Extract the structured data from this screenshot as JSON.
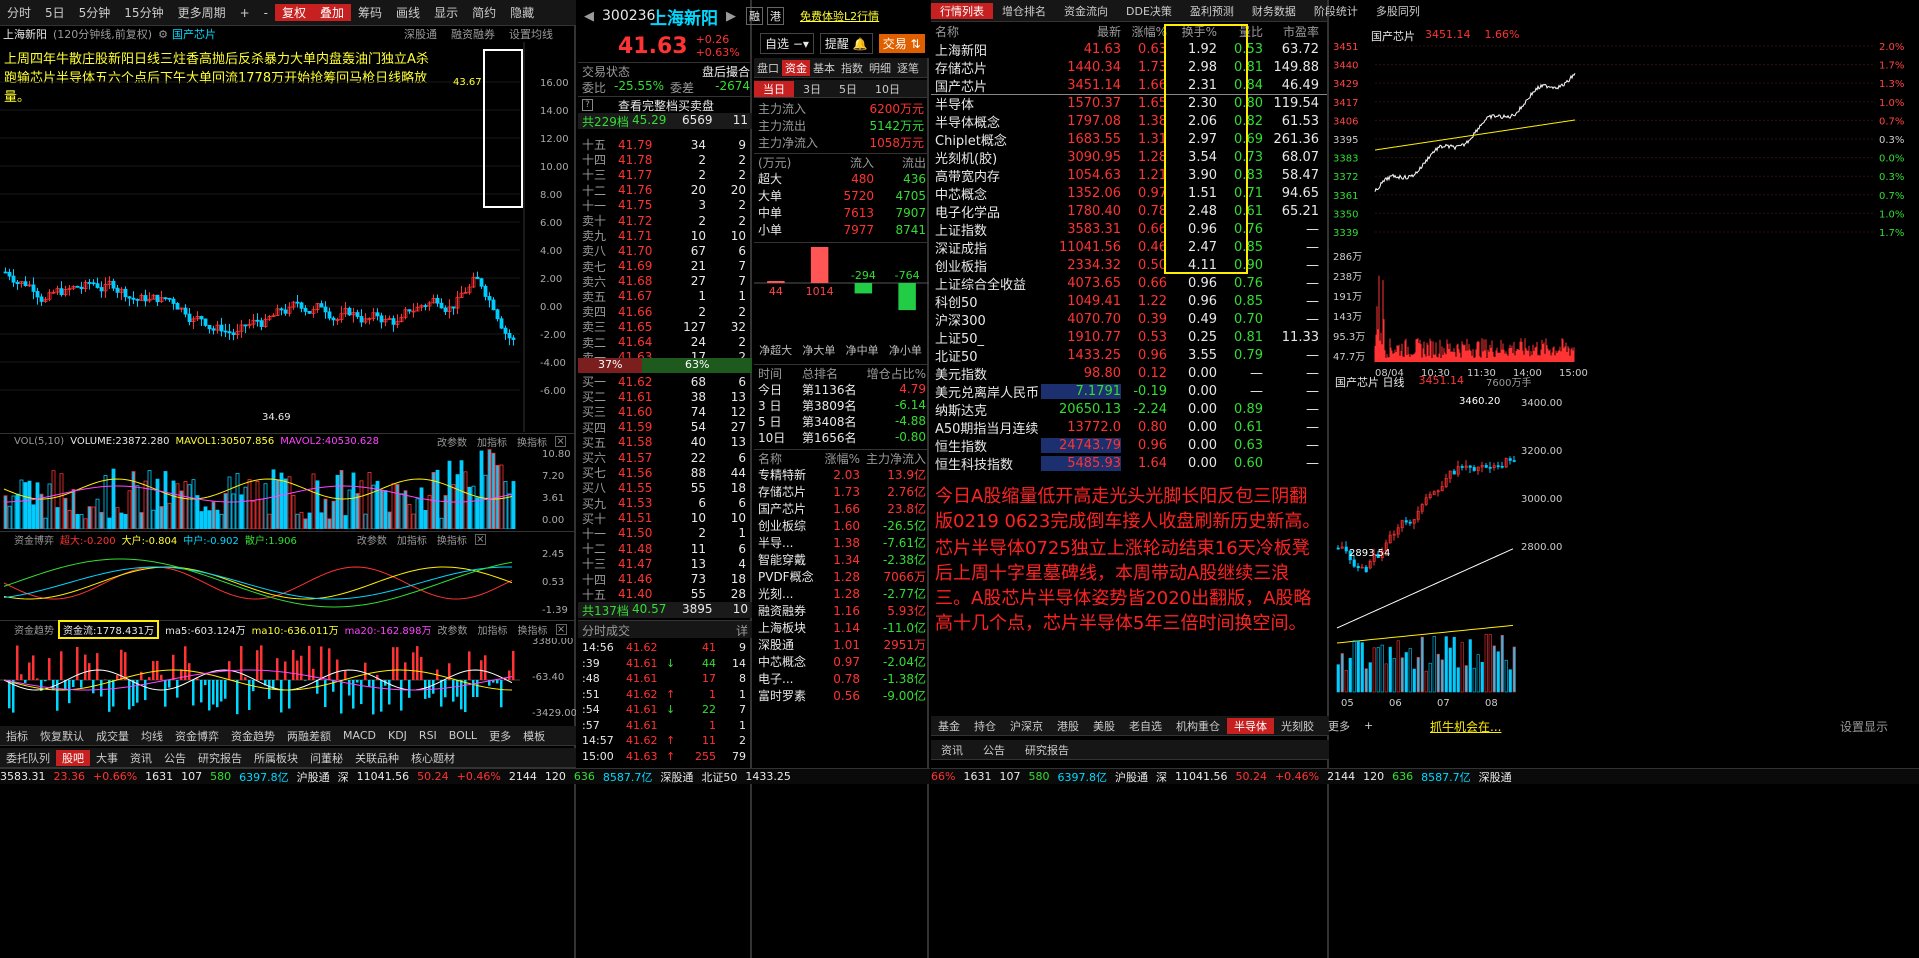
{
  "toolbar": {
    "items": [
      "分时",
      "5日",
      "5分钟",
      "15分钟",
      "更多周期",
      "+",
      "-",
      "复权",
      "叠加",
      "筹码",
      "画线",
      "显示",
      "简约",
      "隐藏"
    ]
  },
  "kline": {
    "stock": "上海新阳",
    "period": "(120分钟线,前复权)",
    "overlay": "国产芯片",
    "tabs": [
      "深股通",
      "融资融券",
      "设置均线"
    ],
    "note": "上周四年牛散庄股新阳日线三炷香高抛后反杀暴力大单内盘轰油门独立A杀跑输芯片半导体五六个点后下午大单回流1778万开始抢筹回马枪日线略放量。",
    "high": "43.67",
    "low": "34.69",
    "yticks": [
      "16.00",
      "14.00",
      "12.00",
      "10.00",
      "8.00",
      "6.00",
      "4.00",
      "2.00",
      "0.00",
      "-2.00",
      "-4.00",
      "-6.00"
    ],
    "vol_title": "VOL(5,10)",
    "vol_vals": "VOLUME:23872.280",
    "mavol1": "MAVOL1:30507.856",
    "mavol2": "MAVOL2:40530.628",
    "vol_ticks": [
      "10.80",
      "7.20",
      "3.61",
      "0.00"
    ],
    "fund_title": "资金博弈",
    "fund_big": "超大:-0.200",
    "fund_da": "大户:-0.804",
    "fund_zh": "中户:-0.902",
    "fund_sa": "散户:1.906",
    "fund_ticks": [
      "2.45",
      "0.53",
      "-1.39"
    ],
    "trend_title": "资金趋势",
    "trend_val": "资金流:1778.431万",
    "ma5": "ma5:-603.124万",
    "ma10": "ma10:-636.011万",
    "ma20": "ma20:-162.898万",
    "trend_ticks": [
      "3380.00",
      "-63.40",
      "-3429.00"
    ],
    "btns": [
      "改参数",
      "加指标",
      "换指标"
    ]
  },
  "bottom_tabs": [
    "指标",
    "恢复默认",
    "成交量",
    "均线",
    "资金博弈",
    "资金趋势",
    "两融差额",
    "MACD",
    "KDJ",
    "RSI",
    "BOLL",
    "更多",
    "模板"
  ],
  "bottom_tabs2": [
    "委托队列",
    "股吧",
    "大事",
    "资讯",
    "公告",
    "研究报告",
    "所属板块",
    "问董秘",
    "关联品种",
    "核心题材"
  ],
  "quote": {
    "code": "300236",
    "name": "上海新阳",
    "price": "41.63",
    "chg": "+0.26",
    "pct": "+0.63%",
    "tags": [
      "融",
      "港"
    ],
    "l2": "免费体验L2行情",
    "selfsel": "自选",
    "remind": "提醒",
    "trade": "交易",
    "state_label": "交易状态",
    "state": "盘后撮合",
    "wb_label": "委比",
    "wb": "-25.55%",
    "wc_label": "委差",
    "wc": "-2674",
    "view_all": "查看完整档买卖盘",
    "sell_total": "共229档",
    "sell_total_p": "45.29",
    "sell_total_v": "6569",
    "sell_total_n": "11",
    "sells": [
      [
        "十五",
        "41.79",
        "34",
        "9"
      ],
      [
        "十四",
        "41.78",
        "2",
        "2"
      ],
      [
        "十三",
        "41.77",
        "2",
        "2"
      ],
      [
        "十二",
        "41.76",
        "20",
        "20"
      ],
      [
        "十一",
        "41.75",
        "3",
        "2"
      ],
      [
        "卖十",
        "41.72",
        "2",
        "2"
      ],
      [
        "卖九",
        "41.71",
        "10",
        "10"
      ],
      [
        "卖八",
        "41.70",
        "67",
        "6"
      ],
      [
        "卖七",
        "41.69",
        "21",
        "7"
      ],
      [
        "卖六",
        "41.68",
        "27",
        "7"
      ],
      [
        "卖五",
        "41.67",
        "1",
        "1"
      ],
      [
        "卖四",
        "41.66",
        "2",
        "2"
      ],
      [
        "卖三",
        "41.65",
        "127",
        "32"
      ],
      [
        "卖二",
        "41.64",
        "24",
        "2"
      ],
      [
        "卖一",
        "41.63",
        "17",
        "2"
      ]
    ],
    "ratio_l": "37%",
    "ratio_r": "63%",
    "buys": [
      [
        "买一",
        "41.62",
        "68",
        "6"
      ],
      [
        "买二",
        "41.61",
        "38",
        "13"
      ],
      [
        "买三",
        "41.60",
        "74",
        "12"
      ],
      [
        "买四",
        "41.59",
        "54",
        "27"
      ],
      [
        "买五",
        "41.58",
        "40",
        "13"
      ],
      [
        "买六",
        "41.57",
        "22",
        "6"
      ],
      [
        "买七",
        "41.56",
        "88",
        "44"
      ],
      [
        "买八",
        "41.55",
        "55",
        "18"
      ],
      [
        "买九",
        "41.53",
        "6",
        "6"
      ],
      [
        "买十",
        "41.51",
        "10",
        "10"
      ],
      [
        "十一",
        "41.50",
        "2",
        "1"
      ],
      [
        "十二",
        "41.48",
        "11",
        "6"
      ],
      [
        "十三",
        "41.47",
        "13",
        "4"
      ],
      [
        "十四",
        "41.46",
        "73",
        "18"
      ],
      [
        "十五",
        "41.40",
        "55",
        "28"
      ]
    ],
    "buy_total": "共137档",
    "buy_total_p": "40.57",
    "buy_total_v": "3895",
    "buy_total_n": "10",
    "ticks_title": "分时成交",
    "ticks_btn": "详",
    "ticks": [
      [
        "14:56",
        "41.62",
        "",
        "41",
        "9"
      ],
      [
        ":39",
        "41.61",
        "↓",
        "44",
        "14"
      ],
      [
        ":48",
        "41.61",
        "",
        "17",
        "8"
      ],
      [
        ":51",
        "41.62",
        "↑",
        "1",
        "1"
      ],
      [
        ":54",
        "41.61",
        "↓",
        "22",
        "7"
      ],
      [
        ":57",
        "41.61",
        "",
        "1",
        "1"
      ],
      [
        "14:57",
        "41.62",
        "↑",
        "11",
        "2"
      ],
      [
        "15:00",
        "41.63",
        "↑",
        "255",
        "79"
      ]
    ]
  },
  "flow": {
    "tabs": [
      "盘口",
      "资金",
      "基本",
      "指数",
      "明细",
      "逐笔"
    ],
    "day_tabs": [
      "当日",
      "3日",
      "5日",
      "10日"
    ],
    "in_label": "主力流入",
    "in": "6200万元",
    "out_label": "主力流出",
    "out": "5142万元",
    "net_label": "主力净流入",
    "net": "1058万元",
    "hdr": [
      "(万元)",
      "流入",
      "流出"
    ],
    "rows": [
      [
        "超大",
        "480",
        "436"
      ],
      [
        "大单",
        "5720",
        "4705"
      ],
      [
        "中单",
        "7613",
        "7907"
      ],
      [
        "小单",
        "7977",
        "8741"
      ]
    ],
    "bars": [
      {
        "name": "净超大",
        "v": 44
      },
      {
        "name": "净大单",
        "v": 1014
      },
      {
        "name": "净中单",
        "v": -294
      },
      {
        "name": "净小单",
        "v": -764
      }
    ],
    "rank_hdr": [
      "时间",
      "总排名",
      "增仓占比%"
    ],
    "rank": [
      [
        "今日",
        "第1136名",
        "4.79"
      ],
      [
        "3 日",
        "第3809名",
        "-6.14"
      ],
      [
        "5 日",
        "第3408名",
        "-4.88"
      ],
      [
        "10日",
        "第1656名",
        "-0.80"
      ]
    ],
    "sec_hdr": [
      "名称",
      "涨幅%",
      "主力净流入"
    ],
    "sectors": [
      [
        "专精特新",
        "2.03",
        "13.9亿"
      ],
      [
        "存储芯片",
        "1.73",
        "2.76亿"
      ],
      [
        "国产芯片",
        "1.66",
        "23.8亿"
      ],
      [
        "创业板综",
        "1.60",
        "-26.5亿"
      ],
      [
        "半导...",
        "1.38",
        "-7.61亿"
      ],
      [
        "智能穿戴",
        "1.34",
        "-2.38亿"
      ],
      [
        "PVDF概念",
        "1.28",
        "7066万"
      ],
      [
        "光刻...",
        "1.28",
        "-2.77亿"
      ],
      [
        "融资融券",
        "1.16",
        "5.93亿"
      ],
      [
        "上海板块",
        "1.14",
        "-11.0亿"
      ],
      [
        "深股通",
        "1.01",
        "2951万"
      ],
      [
        "中芯概念",
        "0.97",
        "-2.04亿"
      ],
      [
        "电子...",
        "0.78",
        "-1.38亿"
      ],
      [
        "富时罗素",
        "0.56",
        "-9.00亿"
      ]
    ]
  },
  "market": {
    "tabs": [
      "行情列表",
      "增仓排名",
      "资金流向",
      "DDE决策",
      "盈利预测",
      "财务数据",
      "阶段统计",
      "多股同列"
    ],
    "hdr": [
      "名称",
      "最新",
      "涨幅%",
      "换手%",
      "量比",
      "市盈率"
    ],
    "rows": [
      [
        "上海新阳",
        "41.63",
        "0.63",
        "1.92",
        "0.53",
        "63.72"
      ],
      [
        "存储芯片",
        "1440.34",
        "1.73",
        "2.98",
        "0.81",
        "149.88"
      ],
      [
        "国产芯片",
        "3451.14",
        "1.66",
        "2.31",
        "0.84",
        "46.49"
      ],
      [
        "半导体",
        "1570.37",
        "1.65",
        "2.30",
        "0.80",
        "119.54"
      ],
      [
        "半导体概念",
        "1797.08",
        "1.38",
        "2.06",
        "0.82",
        "61.53"
      ],
      [
        "Chiplet概念",
        "1683.55",
        "1.31",
        "2.97",
        "0.69",
        "261.36"
      ],
      [
        "光刻机(胶)",
        "3090.95",
        "1.28",
        "3.54",
        "0.73",
        "68.07"
      ],
      [
        "高带宽内存",
        "1054.63",
        "1.21",
        "3.90",
        "0.83",
        "58.47"
      ],
      [
        "中芯概念",
        "1352.06",
        "0.97",
        "1.51",
        "0.71",
        "94.65"
      ],
      [
        "电子化学品",
        "1780.40",
        "0.78",
        "2.48",
        "0.61",
        "65.21"
      ],
      [
        "上证指数",
        "3583.31",
        "0.66",
        "0.96",
        "0.76",
        "—"
      ],
      [
        "深证成指",
        "11041.56",
        "0.46",
        "2.47",
        "0.85",
        "—"
      ],
      [
        "创业板指",
        "2334.32",
        "0.50",
        "4.11",
        "0.90",
        "—"
      ],
      [
        "上证综合全收益",
        "4073.65",
        "0.66",
        "0.96",
        "0.76",
        "—"
      ],
      [
        "科创50",
        "1049.41",
        "1.22",
        "0.96",
        "0.85",
        "—"
      ],
      [
        "沪深300",
        "4070.70",
        "0.39",
        "0.49",
        "0.70",
        "—"
      ],
      [
        "上证50_",
        "1910.77",
        "0.53",
        "0.25",
        "0.81",
        "11.33"
      ],
      [
        "北证50",
        "1433.25",
        "0.96",
        "3.55",
        "0.79",
        "—"
      ],
      [
        "美元指数",
        "98.80",
        "0.12",
        "0.00",
        "—",
        "—"
      ],
      [
        "美元兑离岸人民币",
        "7.1791",
        "-0.19",
        "0.00",
        "—",
        "—"
      ],
      [
        "纳斯达克",
        "20650.13",
        "-2.24",
        "0.00",
        "0.89",
        "—"
      ],
      [
        "A50期指当月连续",
        "13772.0",
        "0.80",
        "0.00",
        "0.61",
        "—"
      ],
      [
        "恒生指数",
        "24743.79",
        "0.96",
        "0.00",
        "0.63",
        "—"
      ],
      [
        "恒生科技指数",
        "5485.93",
        "1.64",
        "0.00",
        "0.60",
        "—"
      ]
    ],
    "comment1": "今日A股缩量低开高走光头光脚长阳反包三阴翻版0219 0623完成倒车接人收盘刷新历史新高。",
    "comment2": "芯片半导体0725独立上涨轮动结束16天冷板凳后上周十字星墓碑线，本周带动A股继续三浪三。A股芯片半导体姿势皆2020出翻版，A股略高十几个点，芯片半导体5年三倍时间换空间。",
    "btabs": [
      "基金",
      "持仓",
      "沪深京",
      "港股",
      "美股",
      "老自选",
      "机构重仓",
      "半导体",
      "光刻胶",
      "更多",
      "+"
    ],
    "ad": "抓牛机会在...",
    "setting": "设置显示",
    "btabs2": [
      "资讯",
      "公告",
      "研究报告"
    ]
  },
  "mini": {
    "name": "国产芯片",
    "price": "3451.14",
    "pct": "1.66%",
    "yl": [
      "3451",
      "3440",
      "3429",
      "3417",
      "3406",
      "3395",
      "3383",
      "3372",
      "3361",
      "3350",
      "3339"
    ],
    "yr": [
      "2.0%",
      "1.7%",
      "1.3%",
      "1.0%",
      "0.7%",
      "0.3%",
      "0.0%",
      "0.3%",
      "0.7%",
      "1.0%",
      "1.7%"
    ],
    "vl": [
      "286万",
      "238万",
      "191万",
      "143万",
      "95.3万",
      "47.7万"
    ],
    "xt": [
      "08/04",
      "10:30",
      "11:30",
      "14:00",
      "15:00"
    ],
    "day_name": "国产芯片 日线",
    "day_price": "3451.14",
    "day_vol": "7600万手",
    "day_hi": "3460.20",
    "day_lo": "2893.54",
    "dy": [
      "3400.00",
      "3200.00",
      "3000.00",
      "2800.00"
    ],
    "dx": [
      "05",
      "06",
      "07",
      "08"
    ]
  },
  "status": {
    "items": [
      [
        "3583.31",
        ""
      ],
      [
        "23.36",
        "r"
      ],
      [
        "+0.66%",
        "r"
      ],
      [
        "1631",
        "w"
      ],
      [
        "107",
        "w"
      ],
      [
        "580",
        "g"
      ],
      [
        "6397.8亿",
        "c"
      ],
      [
        "沪股通",
        "w"
      ],
      [
        "深",
        "w"
      ],
      [
        "11041.56",
        "w"
      ],
      [
        "50.24",
        "r"
      ],
      [
        "+0.46%",
        "r"
      ],
      [
        "2144",
        "w"
      ],
      [
        "120",
        "w"
      ],
      [
        "636",
        "g"
      ],
      [
        "8587.7亿",
        "c"
      ],
      [
        "深股通",
        "w"
      ],
      [
        "北证50",
        "w"
      ],
      [
        "1433.25",
        "w"
      ]
    ],
    "items2": [
      [
        "66%",
        "r"
      ],
      [
        "1631",
        "w"
      ],
      [
        "107",
        "w"
      ],
      [
        "580",
        "g"
      ],
      [
        "6397.8亿",
        "c"
      ],
      [
        "沪股通",
        "w"
      ],
      [
        "深",
        "w"
      ],
      [
        "11041.56",
        "w"
      ],
      [
        "50.24",
        "r"
      ],
      [
        "+0.46%",
        "r"
      ],
      [
        "2144",
        "w"
      ],
      [
        "120",
        "w"
      ],
      [
        "636",
        "g"
      ],
      [
        "8587.7亿",
        "c"
      ],
      [
        "深股通",
        "w"
      ]
    ]
  }
}
